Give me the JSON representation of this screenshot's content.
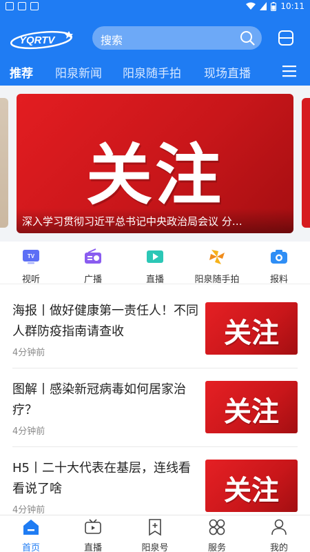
{
  "status_bar": {
    "time": "10:11"
  },
  "header": {
    "logo_text": "YQRTV",
    "search_placeholder": "搜索"
  },
  "tabs": [
    {
      "label": "推荐",
      "active": true
    },
    {
      "label": "阳泉新闻"
    },
    {
      "label": "阳泉随手拍"
    },
    {
      "label": "现场直播"
    }
  ],
  "banner": {
    "big_text": "关注",
    "caption": "深入学习贯彻习近平总书记中央政治局会议 分…"
  },
  "shortcuts": [
    {
      "label": "视听",
      "icon": "tv-icon"
    },
    {
      "label": "广播",
      "icon": "radio-icon"
    },
    {
      "label": "直播",
      "icon": "video-icon"
    },
    {
      "label": "阳泉随手拍",
      "icon": "pinwheel-icon"
    },
    {
      "label": "报料",
      "icon": "camera-icon"
    }
  ],
  "news": [
    {
      "title": "海报丨做好健康第一责任人！不同人群防疫指南请查收",
      "time": "4分钟前",
      "thumb_text": "关注"
    },
    {
      "title": "图解丨感染新冠病毒如何居家治疗？",
      "time": "4分钟前",
      "thumb_text": "关注"
    },
    {
      "title": "H5丨二十大代表在基层，连线看看说了啥",
      "time": "4分钟前",
      "thumb_text": "关注"
    }
  ],
  "bottom_nav": [
    {
      "label": "首页",
      "icon": "home-icon",
      "active": true
    },
    {
      "label": "直播",
      "icon": "live-icon"
    },
    {
      "label": "阳泉号",
      "icon": "bookmark-icon"
    },
    {
      "label": "服务",
      "icon": "services-icon"
    },
    {
      "label": "我的",
      "icon": "profile-icon"
    }
  ],
  "colors": {
    "brand_blue": "#1f7cf3",
    "accent_red": "#d61b1f"
  }
}
